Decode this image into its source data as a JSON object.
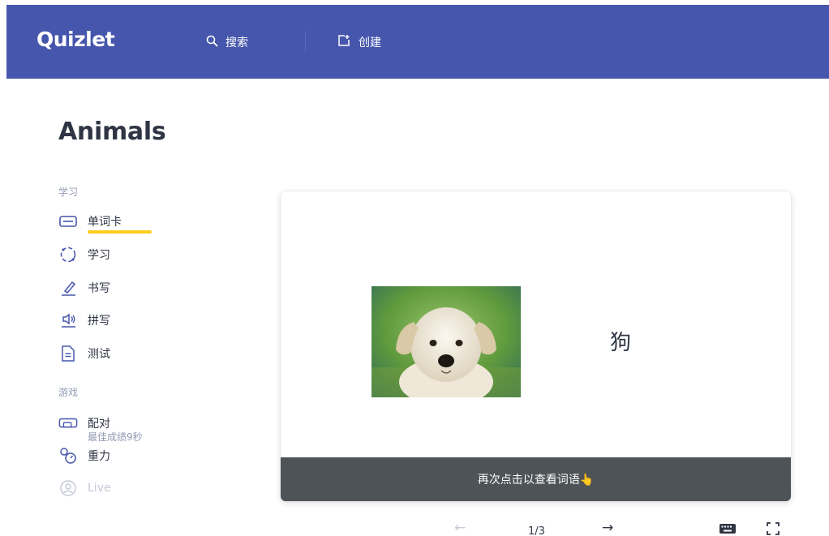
{
  "header": {
    "logo": "Quizlet",
    "search_label": "搜索",
    "create_label": "创建"
  },
  "page": {
    "title": "Animals"
  },
  "sidebar": {
    "study_section": "学习",
    "study_items": [
      {
        "label": "单词卡",
        "icon": "flashcards-icon"
      },
      {
        "label": "学习",
        "icon": "learn-icon"
      },
      {
        "label": "书写",
        "icon": "write-icon"
      },
      {
        "label": "拼写",
        "icon": "spell-icon"
      },
      {
        "label": "测试",
        "icon": "test-icon"
      }
    ],
    "games_section": "游戏",
    "game_items": [
      {
        "label": "配对",
        "note": "最佳成绩9秒",
        "icon": "match-icon"
      },
      {
        "label": "重力",
        "icon": "gravity-icon"
      },
      {
        "label": "Live",
        "icon": "live-icon"
      }
    ]
  },
  "flashcard": {
    "term": "狗",
    "image_alt": "puppy",
    "footer_hint": "再次点击以查看词语👆"
  },
  "controls": {
    "counter": "1/3",
    "prev_glyph": "←",
    "next_glyph": "→"
  },
  "colors": {
    "brand": "#4656ac",
    "accent_underline": "#ffcd1f",
    "card_footer": "#4d5356"
  }
}
